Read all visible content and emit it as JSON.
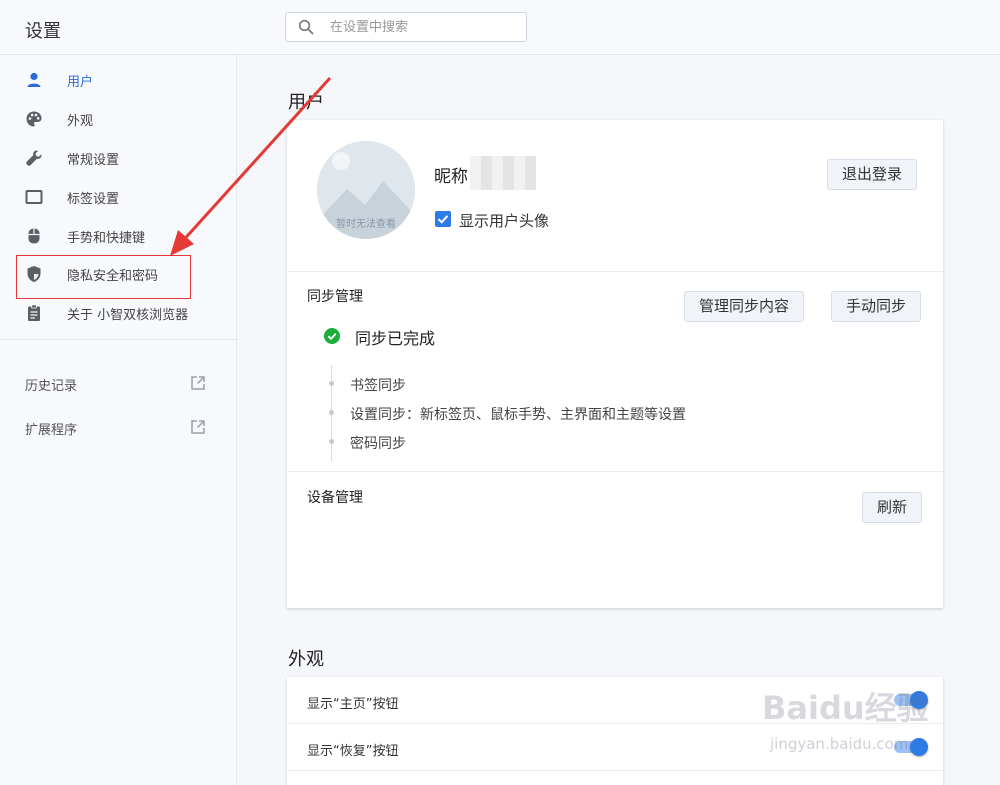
{
  "header": {
    "title": "设置",
    "search": {
      "placeholder": "在设置中搜索",
      "value": ""
    }
  },
  "sidebar": {
    "items": [
      {
        "label": "用户",
        "icon": "user-icon",
        "active": true
      },
      {
        "label": "外观",
        "icon": "palette-icon"
      },
      {
        "label": "常规设置",
        "icon": "wrench-icon"
      },
      {
        "label": "标签设置",
        "icon": "tab-icon"
      },
      {
        "label": "手势和快捷键",
        "icon": "mouse-icon"
      },
      {
        "label": "隐私安全和密码",
        "icon": "shield-icon"
      },
      {
        "label": "关于 小智双核浏览器",
        "icon": "clipboard-icon"
      }
    ],
    "links": [
      {
        "label": "历史记录",
        "icon": "external-link-icon"
      },
      {
        "label": "扩展程序",
        "icon": "external-link-icon"
      }
    ]
  },
  "user_section": {
    "title": "用户",
    "avatar_note": "暂时无法查看",
    "nickname_label": "昵称",
    "show_avatar_label": "显示用户头像",
    "show_avatar_checked": true,
    "logout_button": "退出登录",
    "sync": {
      "title": "同步管理",
      "manage_button": "管理同步内容",
      "manual_button": "手动同步",
      "status": "同步已完成",
      "items": [
        "书签同步",
        "设置同步：新标签页、鼠标手势、主界面和主题等设置",
        "密码同步"
      ]
    },
    "devices": {
      "title": "设备管理",
      "refresh_button": "刷新"
    }
  },
  "appearance_section": {
    "title": "外观",
    "rows": [
      {
        "label": "显示“主页”按钮",
        "enabled": true
      },
      {
        "label": "显示“恢复”按钮",
        "enabled": true
      }
    ]
  },
  "watermark": {
    "logo": "Baidu经验",
    "url": "jingyan.baidu.com"
  },
  "colors": {
    "accent": "#2e7be6",
    "active_nav": "#2c6bd6",
    "success": "#1aad3a",
    "annotation": "#e53935"
  }
}
